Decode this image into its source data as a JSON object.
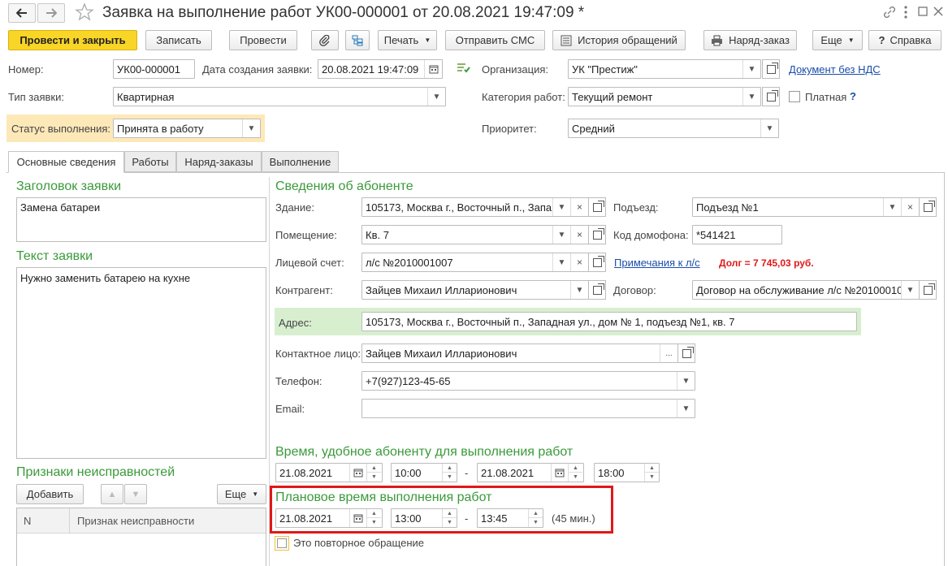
{
  "window": {
    "title": "Заявка на выполнение работ УК00-000001 от 20.08.2021 19:47:09 *",
    "back_icon": "arrow-left-icon",
    "forward_icon": "arrow-right-icon",
    "favorite_icon": "star-icon",
    "link_icon": "link-icon",
    "menu_icon": "more-icon",
    "maximize_icon": "maximize-icon",
    "close_icon": "close-icon"
  },
  "toolbar": {
    "post_close": "Провести и закрыть",
    "save": "Записать",
    "post": "Провести",
    "print": "Печать",
    "send_sms": "Отправить СМС",
    "history": "История обращений",
    "work_order": "Наряд-заказ",
    "more": "Еще",
    "help": "Справка",
    "help_glyph": "?"
  },
  "header": {
    "number_label": "Номер:",
    "number_value": "УК00-000001",
    "created_label": "Дата создания заявки:",
    "created_value": "20.08.2021 19:47:09",
    "org_label": "Организация:",
    "org_value": "УК \"Престиж\"",
    "doc_link": "Документ без НДС",
    "type_label": "Тип заявки:",
    "type_value": "Квартирная",
    "category_label": "Категория работ:",
    "category_value": "Текущий ремонт",
    "paid_label": "Платная",
    "paid_help": "?",
    "status_label": "Статус выполнения:",
    "status_value": "Принята в работу",
    "priority_label": "Приоритет:",
    "priority_value": "Средний"
  },
  "tabs": [
    {
      "label": "Основные сведения"
    },
    {
      "label": "Работы"
    },
    {
      "label": "Наряд-заказы"
    },
    {
      "label": "Выполнение"
    }
  ],
  "left": {
    "title_header": "Заголовок заявки",
    "title_value": "Замена батареи",
    "text_header": "Текст заявки",
    "text_value": "Нужно заменить батарею на кухне",
    "faults_header": "Признаки неисправностей",
    "add_button": "Добавить",
    "more_button": "Еще",
    "col_n": "N",
    "col_sign": "Признак неисправности"
  },
  "subscriber": {
    "header": "Сведения об абоненте",
    "building_label": "Здание:",
    "building_value": "105173, Москва г., Восточный п., Запа",
    "entrance_label": "Подъезд:",
    "entrance_value": "Подъезд №1",
    "room_label": "Помещение:",
    "room_value": "Кв. 7",
    "intercom_label": "Код домофона:",
    "intercom_value": "*541421",
    "account_label": "Лицевой счет:",
    "account_value": "л/с №2010001007",
    "notes_link": "Примечания к л/с",
    "debt": "Долг = 7 745,03 руб.",
    "contractor_label": "Контрагент:",
    "contractor_value": "Зайцев Михаил Илларионович",
    "contract_label": "Договор:",
    "contract_value": "Договор на обслуживание л/с №20100010",
    "address_label": "Адрес:",
    "address_value": "105173, Москва г., Восточный п., Западная ул., дом № 1, подъезд №1, кв. 7",
    "contact_label": "Контактное лицо:",
    "contact_value": "Зайцев Михаил Илларионович",
    "phone_label": "Телефон:",
    "phone_value": "+7(927)123-45-65",
    "email_label": "Email:",
    "email_value": ""
  },
  "convenient": {
    "header": "Время, удобное абоненту для выполнения работ",
    "date_from": "21.08.2021",
    "time_from": "10:00",
    "dash": "-",
    "date_to": "21.08.2021",
    "time_to": "18:00"
  },
  "planned": {
    "header": "Плановое время выполнения работ",
    "date": "21.08.2021",
    "time_from": "13:00",
    "dash": "-",
    "time_to": "13:45",
    "duration": "(45 мин.)"
  },
  "repeat_label": "Это повторное обращение",
  "colors": {
    "primary_button": "#f8d527",
    "section_header": "#3a9a3a",
    "status_bg": "#fde8b8",
    "address_bg": "#d7efcf",
    "highlight_border": "#e01818",
    "debt": "#e01818",
    "link": "#1a4ea8"
  }
}
